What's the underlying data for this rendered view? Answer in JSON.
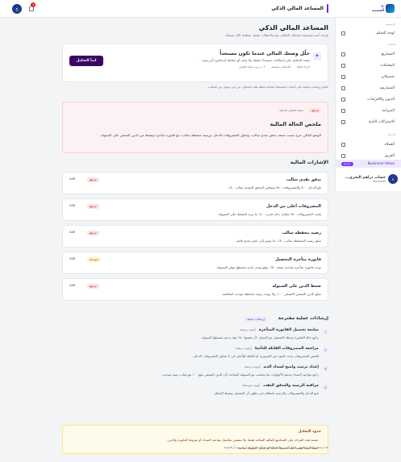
{
  "topbar": {
    "title": "المساعد المالي الذكي",
    "avatar": "ج",
    "notif_count": "1",
    "logo_text": "ذا ألمستند"
  },
  "sidebar": {
    "section_main": "الرئيسية",
    "home": "لوحة التحكم",
    "section_finance": "المالية",
    "items": [
      {
        "label": "المشاريع"
      },
      {
        "label": "المعاملات"
      },
      {
        "label": "تحصيلاتي"
      },
      {
        "label": "المصاريف"
      },
      {
        "label": "الديون والالتزامات"
      },
      {
        "label": "الميزانية"
      },
      {
        "label": "الاشتراكات الثابتة"
      }
    ],
    "section_more": "الأشياء",
    "more_items": [
      {
        "label": "العملاء"
      },
      {
        "label": "الفريق"
      }
    ],
    "active_item": {
      "label": "Business Ideas",
      "badge": "جديدة"
    },
    "user": {
      "avatar": "ج",
      "name": "حساب دراهم التجري...",
      "plan": "Business"
    }
  },
  "page": {
    "title": "المساعد المالي الذكي",
    "subtitle": "قراءة آمنة ومجمعة لبياناتك المالية، مع ملاحظات عملية منظمة لكل منشأة."
  },
  "hero": {
    "title": "حلّل وضعك المالي عندما تكون مستعداً",
    "desc": "يعتمد التحليل على إجماليات مستندك فقط، ولا يعتبر أي معاملة أو فاتورة أو رصيد...",
    "chips": [
      "قراءة فقط",
      "العمليات محصنة",
      "٣ ب ريم شبكة التحليل"
    ],
    "button": "ابدأ التحليل",
    "note": "النتائج إرشادية وتعتمد على البيانات المسجلة المتاحة لحظة طلب التحليل، من دون تحويل بين العملات."
  },
  "summary": {
    "badge": "مرتفع",
    "label": "نتيجة التحليل الحالية",
    "title": "ملخص الحالة المالية",
    "text": "الوضع المالي حرج بسبب ضعف تدفق نقدي سالب، وتجاوز المصروفات للدخل، ورصيد محفظة سالب، مع فاتورة متأخرة وضغط من الدين المتبقي على السيولة."
  },
  "signals": {
    "title": "الإشارات المالية",
    "unit": "SAR",
    "items": [
      {
        "title": "تدفق نقدي سالب",
        "desc": "بلغ الدخل ٨٠٠ والمصروفات ٩٨٠ وصافي التدفق النقدي سالب ١٨٠.",
        "level": "مرتفع",
        "type": "high"
      },
      {
        "title": "المصروفات أعلى من الدخل",
        "desc": "بلغت المصروفات ٩٨٠ مقابل دخل قدره ٨٠٠، ما يزيد الضغط على السيولة.",
        "level": "مرتفع",
        "type": "high"
      },
      {
        "title": "رصيد محفظة سالب",
        "desc": "مبلغ رصيد المحفظة سالب ١٨٠، ما يشير إلى عجز نقدي قائم.",
        "level": "مرتفع",
        "type": "high"
      },
      {
        "title": "فاتورة متأخرة التحصيل",
        "desc": "توجد فاتورة متأخرة واحدة بقيمة ٦٥٠، وهو يؤخر عدم تحصيلها توفر السيولة.",
        "level": "متوسط",
        "type": "med"
      },
      {
        "title": "ضغط الدين على السيولة",
        "desc": "مبلغ الدين المتبقي المتبقي ١٠٠، ولا يوجد رصيد محفظة موجب لمقابلته.",
        "level": "مرتفع",
        "type": "high"
      }
    ]
  },
  "recommendations": {
    "title": "إرشادات عملية مقترحة",
    "badge": "إرشادات عملية",
    "items": [
      {
        "n": "١",
        "title": "متابعة تحصيل الفاتورة المتأخرة",
        "priority": "أولوية مرتفعة",
        "desc": "راجع حالة الفاتورة وخطة التحصيل مع العميل، لأن قيمتها ٦٥٠ وقد يدعم تحصيلها السيولة."
      },
      {
        "n": "٢",
        "title": "مراجعة المصروفات القابلة للتأجيل",
        "priority": "أولوية مرتفعة",
        "desc": "افحص المصروفات وحدد البنود غير الضرورية أو القابلة للتأجيل كي لا تتجاوز المصروفات الدخل."
      },
      {
        "n": "٣",
        "title": "إعداد ترتيب واضح لسداد الدين",
        "priority": "أولوية مرتفعة",
        "desc": "راجع مواعيد السداد وحجم الأولويات بما يتناسب مع السيولة المتاحة، لأن الدين المتبقي يبلغ ١٠٠ مع غياب رصيد موجب."
      },
      {
        "n": "٤",
        "title": "مراقبة الرصيد والتدفق النقدي",
        "priority": "أولوية متوسطة",
        "desc": "تابع الدخل والمصروفات والرصيد بانتظام حتى يظهر أثر التحصيل وضبط الإنفاق."
      }
    ]
  },
  "limits": {
    "title": "حدود التحليل",
    "items": [
      "تعتمد هذه القراءة على المجاميع المالية المتاحة فقط، ولا تتضمن تفاصيل مواعيد السداد أو شروط الفاتورة والدين.",
      "قيمة العقد ليست نقداً محصلاً، لذلك لم تعامل كسيولة متاحة."
    ]
  },
  "footer": "هذا إرشاد تحليلي لتطبيقي فقط وليس نصيحة محاسبية أو استثمارية أو ضريبية أو قانونية."
}
